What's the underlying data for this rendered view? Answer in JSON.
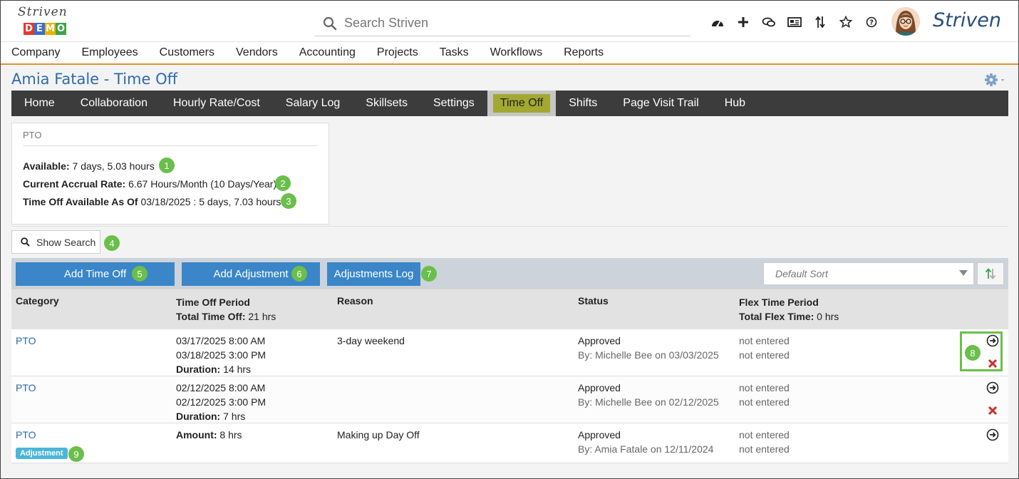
{
  "header": {
    "logo_script": "Striven",
    "logo_demo": [
      "D",
      "E",
      "M",
      "O"
    ],
    "logo_demo_colors": [
      "#e23b2e",
      "#3a6fd1",
      "#e8b400",
      "#3fa34d"
    ],
    "search_placeholder": "Search Striven",
    "brand": "Striven",
    "icons": [
      "dashboard-icon",
      "plus-icon",
      "chat-icon",
      "news-icon",
      "sort-arrows-icon",
      "star-icon",
      "help-icon"
    ]
  },
  "mainnav": [
    "Company",
    "Employees",
    "Customers",
    "Vendors",
    "Accounting",
    "Projects",
    "Tasks",
    "Workflows",
    "Reports"
  ],
  "page": {
    "title": "Amia Fatale - Time Off"
  },
  "subnav": {
    "tabs": [
      "Home",
      "Collaboration",
      "Hourly Rate/Cost",
      "Salary Log",
      "Skillsets",
      "Settings",
      "Time Off",
      "Shifts",
      "Page Visit Trail",
      "Hub"
    ],
    "active": "Time Off"
  },
  "pto": {
    "heading": "PTO",
    "available_label": "Available:",
    "available_value": " 7 days, 5.03 hours",
    "accrual_label": "Current Accrual Rate:",
    "accrual_value": " 6.67 Hours/Month (10 Days/Year)",
    "asof_label": "Time Off Available As Of",
    "asof_value": " 03/18/2025 : 5 days, 7.03 hours"
  },
  "callouts": [
    "1",
    "2",
    "3",
    "4",
    "5",
    "6",
    "7",
    "8",
    "9"
  ],
  "toolbar": {
    "show_search": "Show Search",
    "add_time_off": "Add Time Off",
    "add_adjustment": "Add Adjustment",
    "adjustments_log": "Adjustments Log",
    "sort_placeholder": "Default Sort"
  },
  "table": {
    "headers": {
      "category": "Category",
      "period": "Time Off Period",
      "total_label": "Total Time Off:",
      "total_value": " 21 hrs",
      "reason": "Reason",
      "status": "Status",
      "flex": "Flex Time Period",
      "flex_total_label": "Total Flex Time:",
      "flex_total_value": " 0 hrs"
    },
    "rows": [
      {
        "category": "PTO",
        "start": "03/17/2025 8:00 AM",
        "end": "03/18/2025 3:00 PM",
        "duration_label": "Duration:",
        "duration_value": " 14 hrs",
        "reason": "3-day weekend",
        "status": "Approved",
        "status_by": "By: Michelle Bee on 03/03/2025",
        "flex1": "not entered",
        "flex2": "not entered"
      },
      {
        "category": "PTO",
        "start": "02/12/2025 8:00 AM",
        "end": "02/12/2025 3:00 PM",
        "duration_label": "Duration:",
        "duration_value": " 7 hrs",
        "reason": "",
        "status": "Approved",
        "status_by": "By: Michelle Bee on 02/12/2025",
        "flex1": "not entered",
        "flex2": "not entered"
      },
      {
        "category": "PTO",
        "amount_label": "Amount:",
        "amount_value": " 8 hrs",
        "reason": "Making up Day Off",
        "status": "Approved",
        "status_by": "By: Amia Fatale on 12/11/2024",
        "flex1": "not entered",
        "flex2": "not entered",
        "tag": "Adjustment"
      }
    ]
  }
}
